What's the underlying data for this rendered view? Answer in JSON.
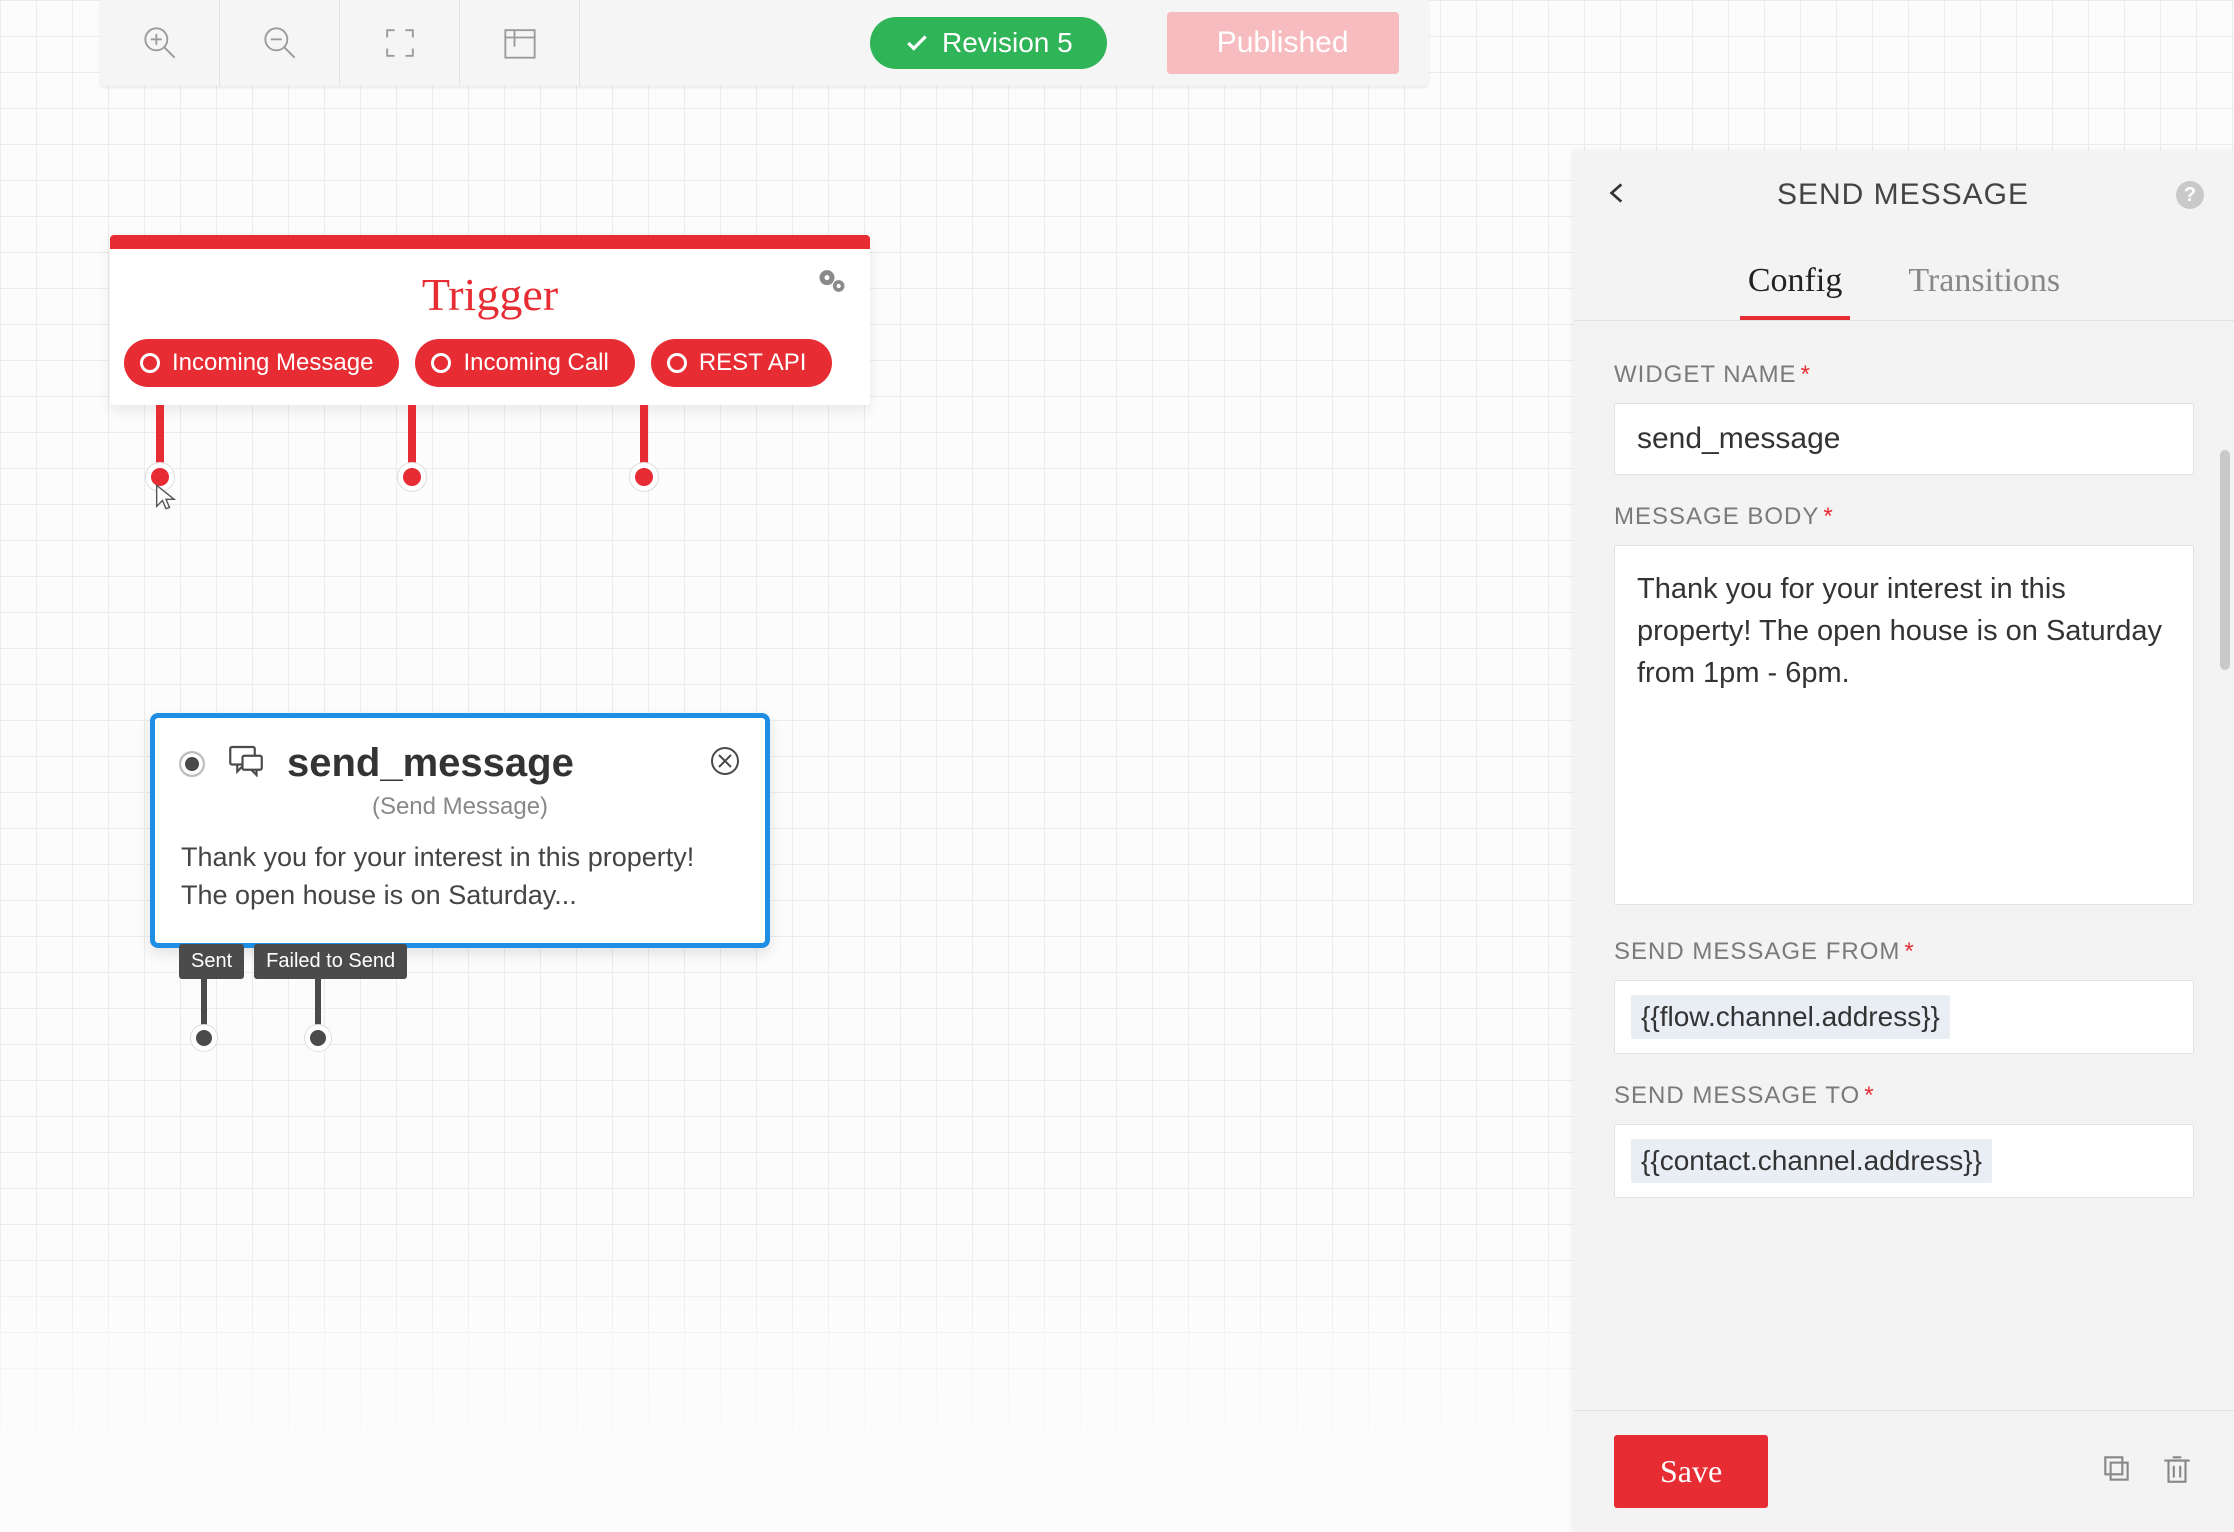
{
  "toolbar": {
    "revision_label": "Revision 5",
    "published_label": "Published"
  },
  "trigger": {
    "title": "Trigger",
    "pills": [
      "Incoming Message",
      "Incoming Call",
      "REST API"
    ]
  },
  "send_node": {
    "name": "send_message",
    "subtitle": "(Send Message)",
    "body_preview": "Thank you for your interest in this property! The open house is on Saturday...",
    "tags": [
      "Sent",
      "Failed to Send"
    ]
  },
  "panel": {
    "title": "SEND MESSAGE",
    "tabs": {
      "config": "Config",
      "transitions": "Transitions"
    },
    "fields": {
      "widget_name_label": "WIDGET NAME",
      "widget_name_value": "send_message",
      "message_body_label": "MESSAGE BODY",
      "message_body_value": "Thank you for your interest in this property! The open house is on Saturday from 1pm - 6pm.",
      "send_from_label": "SEND MESSAGE FROM",
      "send_from_value": "{{flow.channel.address}}",
      "send_to_label": "SEND MESSAGE TO",
      "send_to_value": "{{contact.channel.address}}"
    },
    "save_label": "Save"
  }
}
